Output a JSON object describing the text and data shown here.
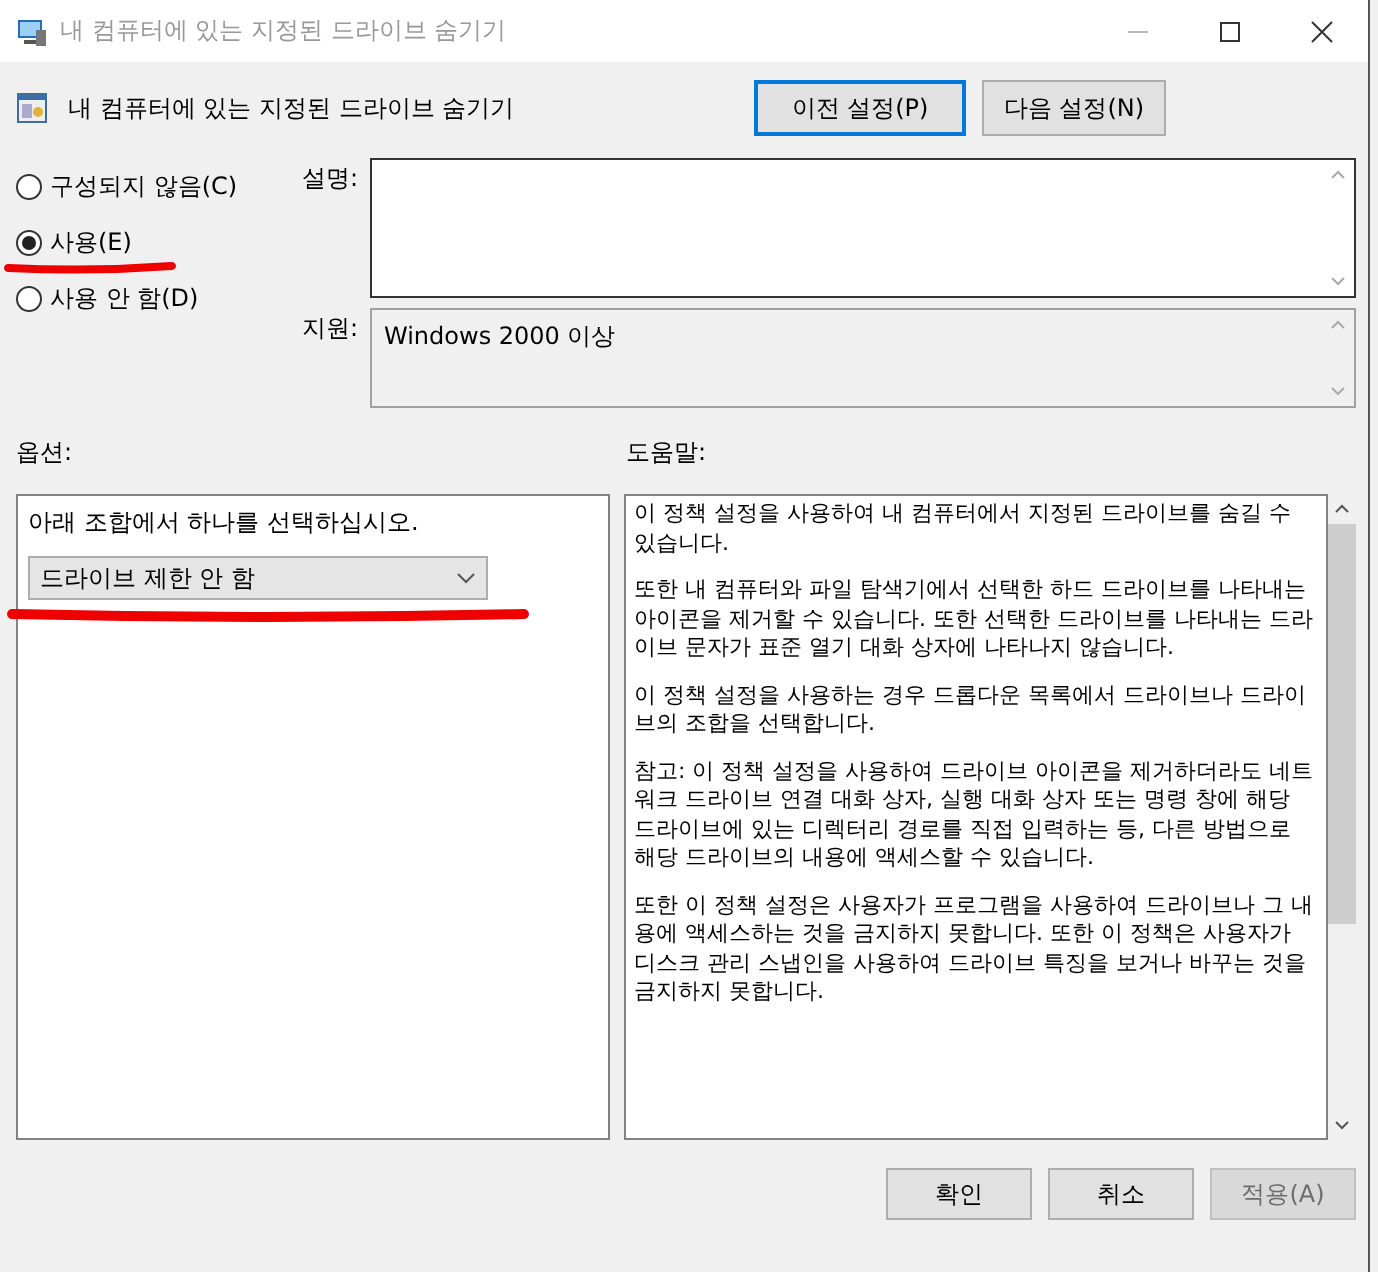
{
  "window": {
    "title": "내 컴퓨터에 있는 지정된 드라이브 숨기기"
  },
  "header": {
    "title": "내 컴퓨터에 있는 지정된 드라이브 숨기기"
  },
  "nav_buttons": [
    {
      "label": "이전 설정(P)",
      "focused": true
    },
    {
      "label": "다음 설정(N)",
      "focused": false
    }
  ],
  "state_options": [
    {
      "label": "구성되지 않음(C)",
      "selected": false
    },
    {
      "label": "사용(E)",
      "selected": true
    },
    {
      "label": "사용 안 함(D)",
      "selected": false
    }
  ],
  "description": {
    "label": "설명:"
  },
  "support": {
    "label": "지원:",
    "value": "Windows 2000 이상"
  },
  "options": {
    "label": "옵션:",
    "prompt": "아래 조합에서 하나를 선택하십시오.",
    "dropdown": {
      "value": "드라이브 제한 안 함"
    }
  },
  "help": {
    "label": "도움말:",
    "paragraphs": [
      "이 정책 설정을 사용하여 내 컴퓨터에서 지정된 드라이브를 숨길 수 있습니다.",
      "또한 내 컴퓨터와 파일 탐색기에서 선택한 하드 드라이브를 나타내는 아이콘을 제거할 수 있습니다. 또한 선택한 드라이브를 나타내는 드라이브 문자가 표준 열기 대화 상자에 나타나지 않습니다.",
      "이 정책 설정을 사용하는 경우 드롭다운 목록에서 드라이브나 드라이브의 조합을 선택합니다.",
      "참고: 이 정책 설정을 사용하여 드라이브 아이콘을 제거하더라도 네트워크 드라이브 연결 대화 상자, 실행 대화 상자 또는 명령 창에 해당 드라이브에 있는 디렉터리 경로를 직접 입력하는 등, 다른 방법으로 해당 드라이브의 내용에 액세스할 수 있습니다.",
      "또한 이 정책 설정은 사용자가 프로그램을 사용하여 드라이브나 그 내용에 액세스하는 것을 금지하지 못합니다. 또한 이 정책은 사용자가 디스크 관리 스냅인을 사용하여 드라이브 특징을 보거나 바꾸는 것을 금지하지 못합니다."
    ]
  },
  "footer_buttons": [
    {
      "label": "확인",
      "disabled": false
    },
    {
      "label": "취소",
      "disabled": false
    },
    {
      "label": "적용(A)",
      "disabled": true
    }
  ]
}
